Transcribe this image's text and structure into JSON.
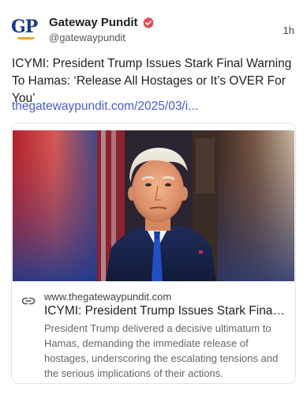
{
  "author": {
    "avatar_text": "GP",
    "name": "Gateway Pundit",
    "handle": "@gatewaypundit",
    "verified_icon": "verified-badge-icon",
    "verified_color": "#e8474f"
  },
  "post": {
    "time": "1h",
    "text": "ICYMI: President Trump Issues Stark Final Warning To Hamas: ‘Release All Hostages or It’s OVER For You’",
    "link_text": "thegatewaypundit.com/2025/03/i...",
    "link_color": "#4a5bd4"
  },
  "link_card": {
    "link_icon": "link-icon",
    "domain": "www.thegatewaypundit.com",
    "title": "ICYMI: President Trump Issues Stark Final War...",
    "description": "President Trump delivered a decisive ultimatum to Hamas, demanding the immediate release of hostages, underscoring the escalating tensions and the serious implications of their actions."
  }
}
